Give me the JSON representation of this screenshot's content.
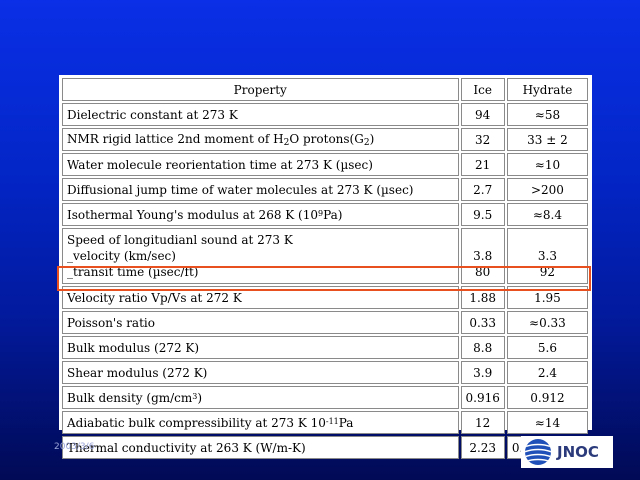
{
  "table": {
    "headers": [
      "Property",
      "Ice",
      "Hydrate"
    ],
    "rows": [
      {
        "property": "Dielectric constant at 273 K",
        "ice": "94",
        "hydrate": "≈58"
      },
      {
        "property_pre": "NMR rigid lattice 2nd moment of H",
        "property_sub1": "2",
        "property_mid": "O protons(G",
        "property_sub2": "2",
        "property_post": ")",
        "ice": "32",
        "hydrate": "33 ± 2"
      },
      {
        "property": "Water molecule reorientation time at 273 K (µsec)",
        "ice": "21",
        "hydrate": "≈10"
      },
      {
        "property": "Diffusional jump time of water molecules at 273 K (µsec)",
        "ice": "2.7",
        "hydrate": ">200"
      },
      {
        "property_pre": "Isothermal Young's modulus at 268 K (10",
        "property_sup": "9",
        "property_post": "Pa)",
        "ice": "9.5",
        "hydrate": "≈8.4"
      },
      {
        "property_line1": "Speed of longitudianl sound at 273 K",
        "property_line2": "_velocity (km/sec)",
        "property_line3": "_transit time (µsec/ft)",
        "ice1": "3.8",
        "ice2": "80",
        "hydrate1": "3.3",
        "hydrate2": "92"
      },
      {
        "property": "Velocity ratio Vp/Vs at 272 K",
        "ice": "1.88",
        "hydrate": "1.95"
      },
      {
        "property": "Poisson's ratio",
        "ice": "0.33",
        "hydrate": "≈0.33"
      },
      {
        "property": "Bulk modulus (272 K)",
        "ice": "8.8",
        "hydrate": "5.6"
      },
      {
        "property": "Shear modulus (272 K)",
        "ice": "3.9",
        "hydrate": "2.4"
      },
      {
        "property_pre": "Bulk density (gm/cm",
        "property_sup": "3",
        "property_post": ")",
        "ice": "0.916",
        "hydrate": "0.912"
      },
      {
        "property_pre": "Adiabatic bulk compressibility at 273 K 10",
        "property_sup": "-11",
        "property_post": "Pa",
        "ice": "12",
        "hydrate": "≈14"
      },
      {
        "property": "Thermal conductivity at 263 K (W/m-K)",
        "ice": "2.23",
        "hydrate": "0.49 ± 0.02"
      }
    ]
  },
  "footer": {
    "date": "2003/3/6"
  },
  "logo": {
    "text": "JNOC",
    "icon": "globe-icon"
  },
  "colors": {
    "background_top": "#0a2fe6",
    "background_bottom": "#010a55",
    "highlight": "#e8501f",
    "logo_text": "#2b3a7a"
  }
}
